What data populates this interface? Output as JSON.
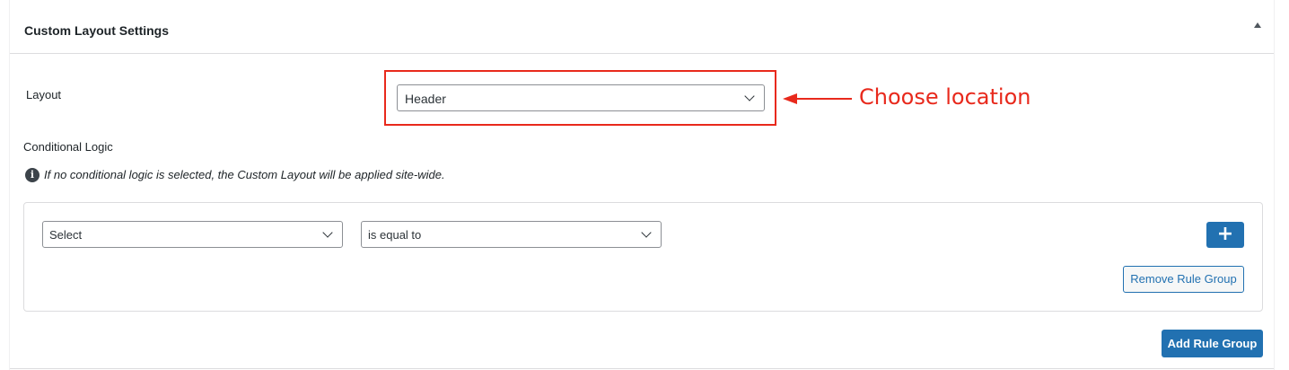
{
  "panel": {
    "title": "Custom Layout Settings",
    "toggle_icon": "triangle-up-icon"
  },
  "layout_field": {
    "label": "Layout",
    "selected": "Header"
  },
  "annotation": {
    "text": "Choose location",
    "color": "#e8291c"
  },
  "conditional_logic": {
    "label": "Conditional Logic",
    "info_icon": "info-circle-icon",
    "info_glyph": "i",
    "info_text": "If no conditional logic is selected, the Custom Layout will be applied site-wide."
  },
  "rule_group": {
    "rule_select": "Select",
    "operator_select": "is equal to",
    "add_rule_label": "+",
    "remove_label": "Remove Rule Group"
  },
  "footer": {
    "add_group_label": "Add Rule Group"
  },
  "colors": {
    "accent": "#2271b1",
    "annotation": "#e8291c",
    "border": "#dcdcde"
  }
}
